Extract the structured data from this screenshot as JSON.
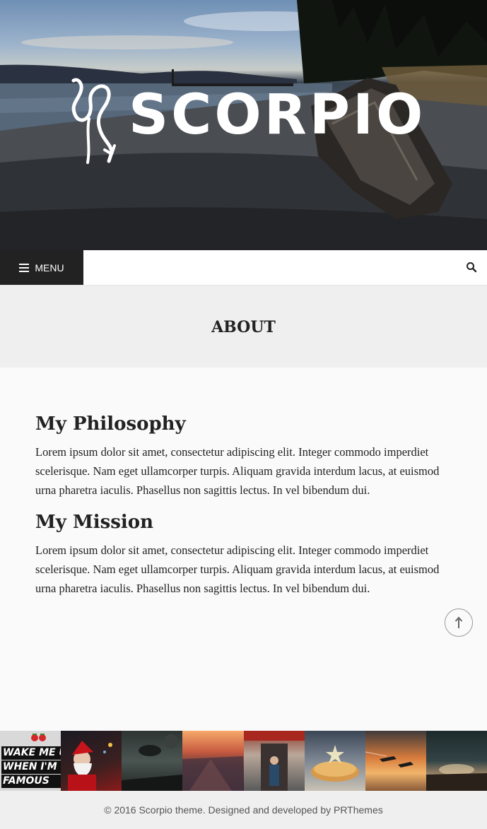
{
  "header": {
    "site_title": "SCORPIO",
    "menu_label": "MENU"
  },
  "page": {
    "title": "ABOUT"
  },
  "sections": [
    {
      "heading": "My Philosophy",
      "body": "Lorem ipsum dolor sit amet, consectetur adipiscing elit. Integer commodo imperdiet scelerisque. Nam eget ullamcorper turpis. Aliquam gravida interdum lacus, at euismod urna pharetra iaculis. Phasellus non sagittis lectus. In vel bibendum dui."
    },
    {
      "heading": "My Mission",
      "body": "Lorem ipsum dolor sit amet, consectetur adipiscing elit. Integer commodo imperdiet scelerisque. Nam eget ullamcorper turpis. Aliquam gravida interdum lacus, at euismod urna pharetra iaculis. Phasellus non sagittis lectus. In vel bibendum dui."
    }
  ],
  "gallery": {
    "first_thumb_text": [
      "WAKE ME UP",
      "WHEN I'M",
      "FAMOUS"
    ]
  },
  "footer": {
    "copyright": "© 2016 Scorpio theme. Designed and developed by PRThemes"
  },
  "icons": {
    "menu": "hamburger-icon",
    "search": "search-icon",
    "back_to_top": "arrow-up-icon",
    "logo": "scorpio-glyph-icon"
  },
  "colors": {
    "menu_bg": "#222222",
    "title_band_bg": "#efefef",
    "body_bg": "#fafafa",
    "footer_bg": "#efefef"
  }
}
